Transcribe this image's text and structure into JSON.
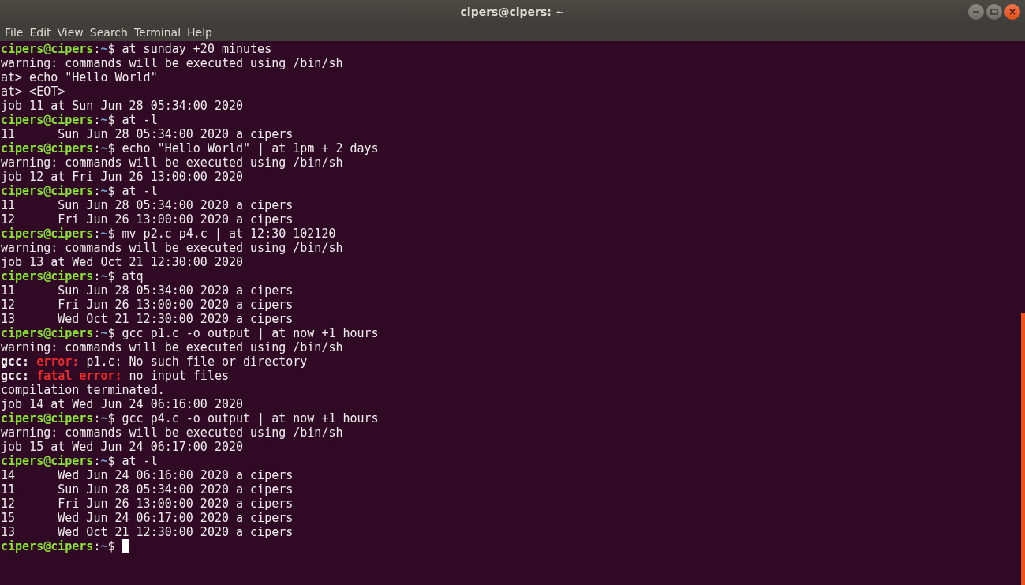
{
  "window": {
    "title": "cipers@cipers: ~"
  },
  "menu": [
    "File",
    "Edit",
    "View",
    "Search",
    "Terminal",
    "Help"
  ],
  "lines": [
    {
      "segments": [
        {
          "kind": "user",
          "text": "cipers@cipers"
        },
        {
          "kind": "plain",
          "text": ":"
        },
        {
          "kind": "path",
          "text": "~"
        },
        {
          "kind": "plain",
          "text": "$ at sunday +20 minutes"
        }
      ]
    },
    {
      "segments": [
        {
          "kind": "plain",
          "text": "warning: commands will be executed using /bin/sh"
        }
      ]
    },
    {
      "segments": [
        {
          "kind": "plain",
          "text": "at> echo \"Hello World\""
        }
      ]
    },
    {
      "segments": [
        {
          "kind": "plain",
          "text": "at> <EOT>"
        }
      ]
    },
    {
      "segments": [
        {
          "kind": "plain",
          "text": "job 11 at Sun Jun 28 05:34:00 2020"
        }
      ]
    },
    {
      "segments": [
        {
          "kind": "user",
          "text": "cipers@cipers"
        },
        {
          "kind": "plain",
          "text": ":"
        },
        {
          "kind": "path",
          "text": "~"
        },
        {
          "kind": "plain",
          "text": "$ at -l"
        }
      ]
    },
    {
      "segments": [
        {
          "kind": "plain",
          "text": "11      Sun Jun 28 05:34:00 2020 a cipers"
        }
      ]
    },
    {
      "segments": [
        {
          "kind": "user",
          "text": "cipers@cipers"
        },
        {
          "kind": "plain",
          "text": ":"
        },
        {
          "kind": "path",
          "text": "~"
        },
        {
          "kind": "plain",
          "text": "$ echo \"Hello World\" | at 1pm + 2 days"
        }
      ]
    },
    {
      "segments": [
        {
          "kind": "plain",
          "text": "warning: commands will be executed using /bin/sh"
        }
      ]
    },
    {
      "segments": [
        {
          "kind": "plain",
          "text": "job 12 at Fri Jun 26 13:00:00 2020"
        }
      ]
    },
    {
      "segments": [
        {
          "kind": "user",
          "text": "cipers@cipers"
        },
        {
          "kind": "plain",
          "text": ":"
        },
        {
          "kind": "path",
          "text": "~"
        },
        {
          "kind": "plain",
          "text": "$ at -l"
        }
      ]
    },
    {
      "segments": [
        {
          "kind": "plain",
          "text": "11      Sun Jun 28 05:34:00 2020 a cipers"
        }
      ]
    },
    {
      "segments": [
        {
          "kind": "plain",
          "text": "12      Fri Jun 26 13:00:00 2020 a cipers"
        }
      ]
    },
    {
      "segments": [
        {
          "kind": "user",
          "text": "cipers@cipers"
        },
        {
          "kind": "plain",
          "text": ":"
        },
        {
          "kind": "path",
          "text": "~"
        },
        {
          "kind": "plain",
          "text": "$ mv p2.c p4.c | at 12:30 102120"
        }
      ]
    },
    {
      "segments": [
        {
          "kind": "plain",
          "text": "warning: commands will be executed using /bin/sh"
        }
      ]
    },
    {
      "segments": [
        {
          "kind": "plain",
          "text": "job 13 at Wed Oct 21 12:30:00 2020"
        }
      ]
    },
    {
      "segments": [
        {
          "kind": "user",
          "text": "cipers@cipers"
        },
        {
          "kind": "plain",
          "text": ":"
        },
        {
          "kind": "path",
          "text": "~"
        },
        {
          "kind": "plain",
          "text": "$ atq"
        }
      ]
    },
    {
      "segments": [
        {
          "kind": "plain",
          "text": "11      Sun Jun 28 05:34:00 2020 a cipers"
        }
      ]
    },
    {
      "segments": [
        {
          "kind": "plain",
          "text": "12      Fri Jun 26 13:00:00 2020 a cipers"
        }
      ]
    },
    {
      "segments": [
        {
          "kind": "plain",
          "text": "13      Wed Oct 21 12:30:00 2020 a cipers"
        }
      ]
    },
    {
      "segments": [
        {
          "kind": "user",
          "text": "cipers@cipers"
        },
        {
          "kind": "plain",
          "text": ":"
        },
        {
          "kind": "path",
          "text": "~"
        },
        {
          "kind": "plain",
          "text": "$ gcc p1.c -o output | at now +1 hours"
        }
      ]
    },
    {
      "segments": [
        {
          "kind": "plain",
          "text": "warning: commands will be executed using /bin/sh"
        }
      ]
    },
    {
      "segments": [
        {
          "kind": "bold",
          "text": "gcc: "
        },
        {
          "kind": "error",
          "text": "error: "
        },
        {
          "kind": "plain",
          "text": "p1.c: No such file or directory"
        }
      ]
    },
    {
      "segments": [
        {
          "kind": "bold",
          "text": "gcc: "
        },
        {
          "kind": "error",
          "text": "fatal error: "
        },
        {
          "kind": "plain",
          "text": "no input files"
        }
      ]
    },
    {
      "segments": [
        {
          "kind": "plain",
          "text": "compilation terminated."
        }
      ]
    },
    {
      "segments": [
        {
          "kind": "plain",
          "text": "job 14 at Wed Jun 24 06:16:00 2020"
        }
      ]
    },
    {
      "segments": [
        {
          "kind": "user",
          "text": "cipers@cipers"
        },
        {
          "kind": "plain",
          "text": ":"
        },
        {
          "kind": "path",
          "text": "~"
        },
        {
          "kind": "plain",
          "text": "$ gcc p4.c -o output | at now +1 hours"
        }
      ]
    },
    {
      "segments": [
        {
          "kind": "plain",
          "text": "warning: commands will be executed using /bin/sh"
        }
      ]
    },
    {
      "segments": [
        {
          "kind": "plain",
          "text": "job 15 at Wed Jun 24 06:17:00 2020"
        }
      ]
    },
    {
      "segments": [
        {
          "kind": "user",
          "text": "cipers@cipers"
        },
        {
          "kind": "plain",
          "text": ":"
        },
        {
          "kind": "path",
          "text": "~"
        },
        {
          "kind": "plain",
          "text": "$ at -l"
        }
      ]
    },
    {
      "segments": [
        {
          "kind": "plain",
          "text": "14      Wed Jun 24 06:16:00 2020 a cipers"
        }
      ]
    },
    {
      "segments": [
        {
          "kind": "plain",
          "text": "11      Sun Jun 28 05:34:00 2020 a cipers"
        }
      ]
    },
    {
      "segments": [
        {
          "kind": "plain",
          "text": "12      Fri Jun 26 13:00:00 2020 a cipers"
        }
      ]
    },
    {
      "segments": [
        {
          "kind": "plain",
          "text": "15      Wed Jun 24 06:17:00 2020 a cipers"
        }
      ]
    },
    {
      "segments": [
        {
          "kind": "plain",
          "text": "13      Wed Oct 21 12:30:00 2020 a cipers"
        }
      ]
    },
    {
      "segments": [
        {
          "kind": "user",
          "text": "cipers@cipers"
        },
        {
          "kind": "plain",
          "text": ":"
        },
        {
          "kind": "path",
          "text": "~"
        },
        {
          "kind": "plain",
          "text": "$ "
        }
      ],
      "cursor": true
    }
  ]
}
